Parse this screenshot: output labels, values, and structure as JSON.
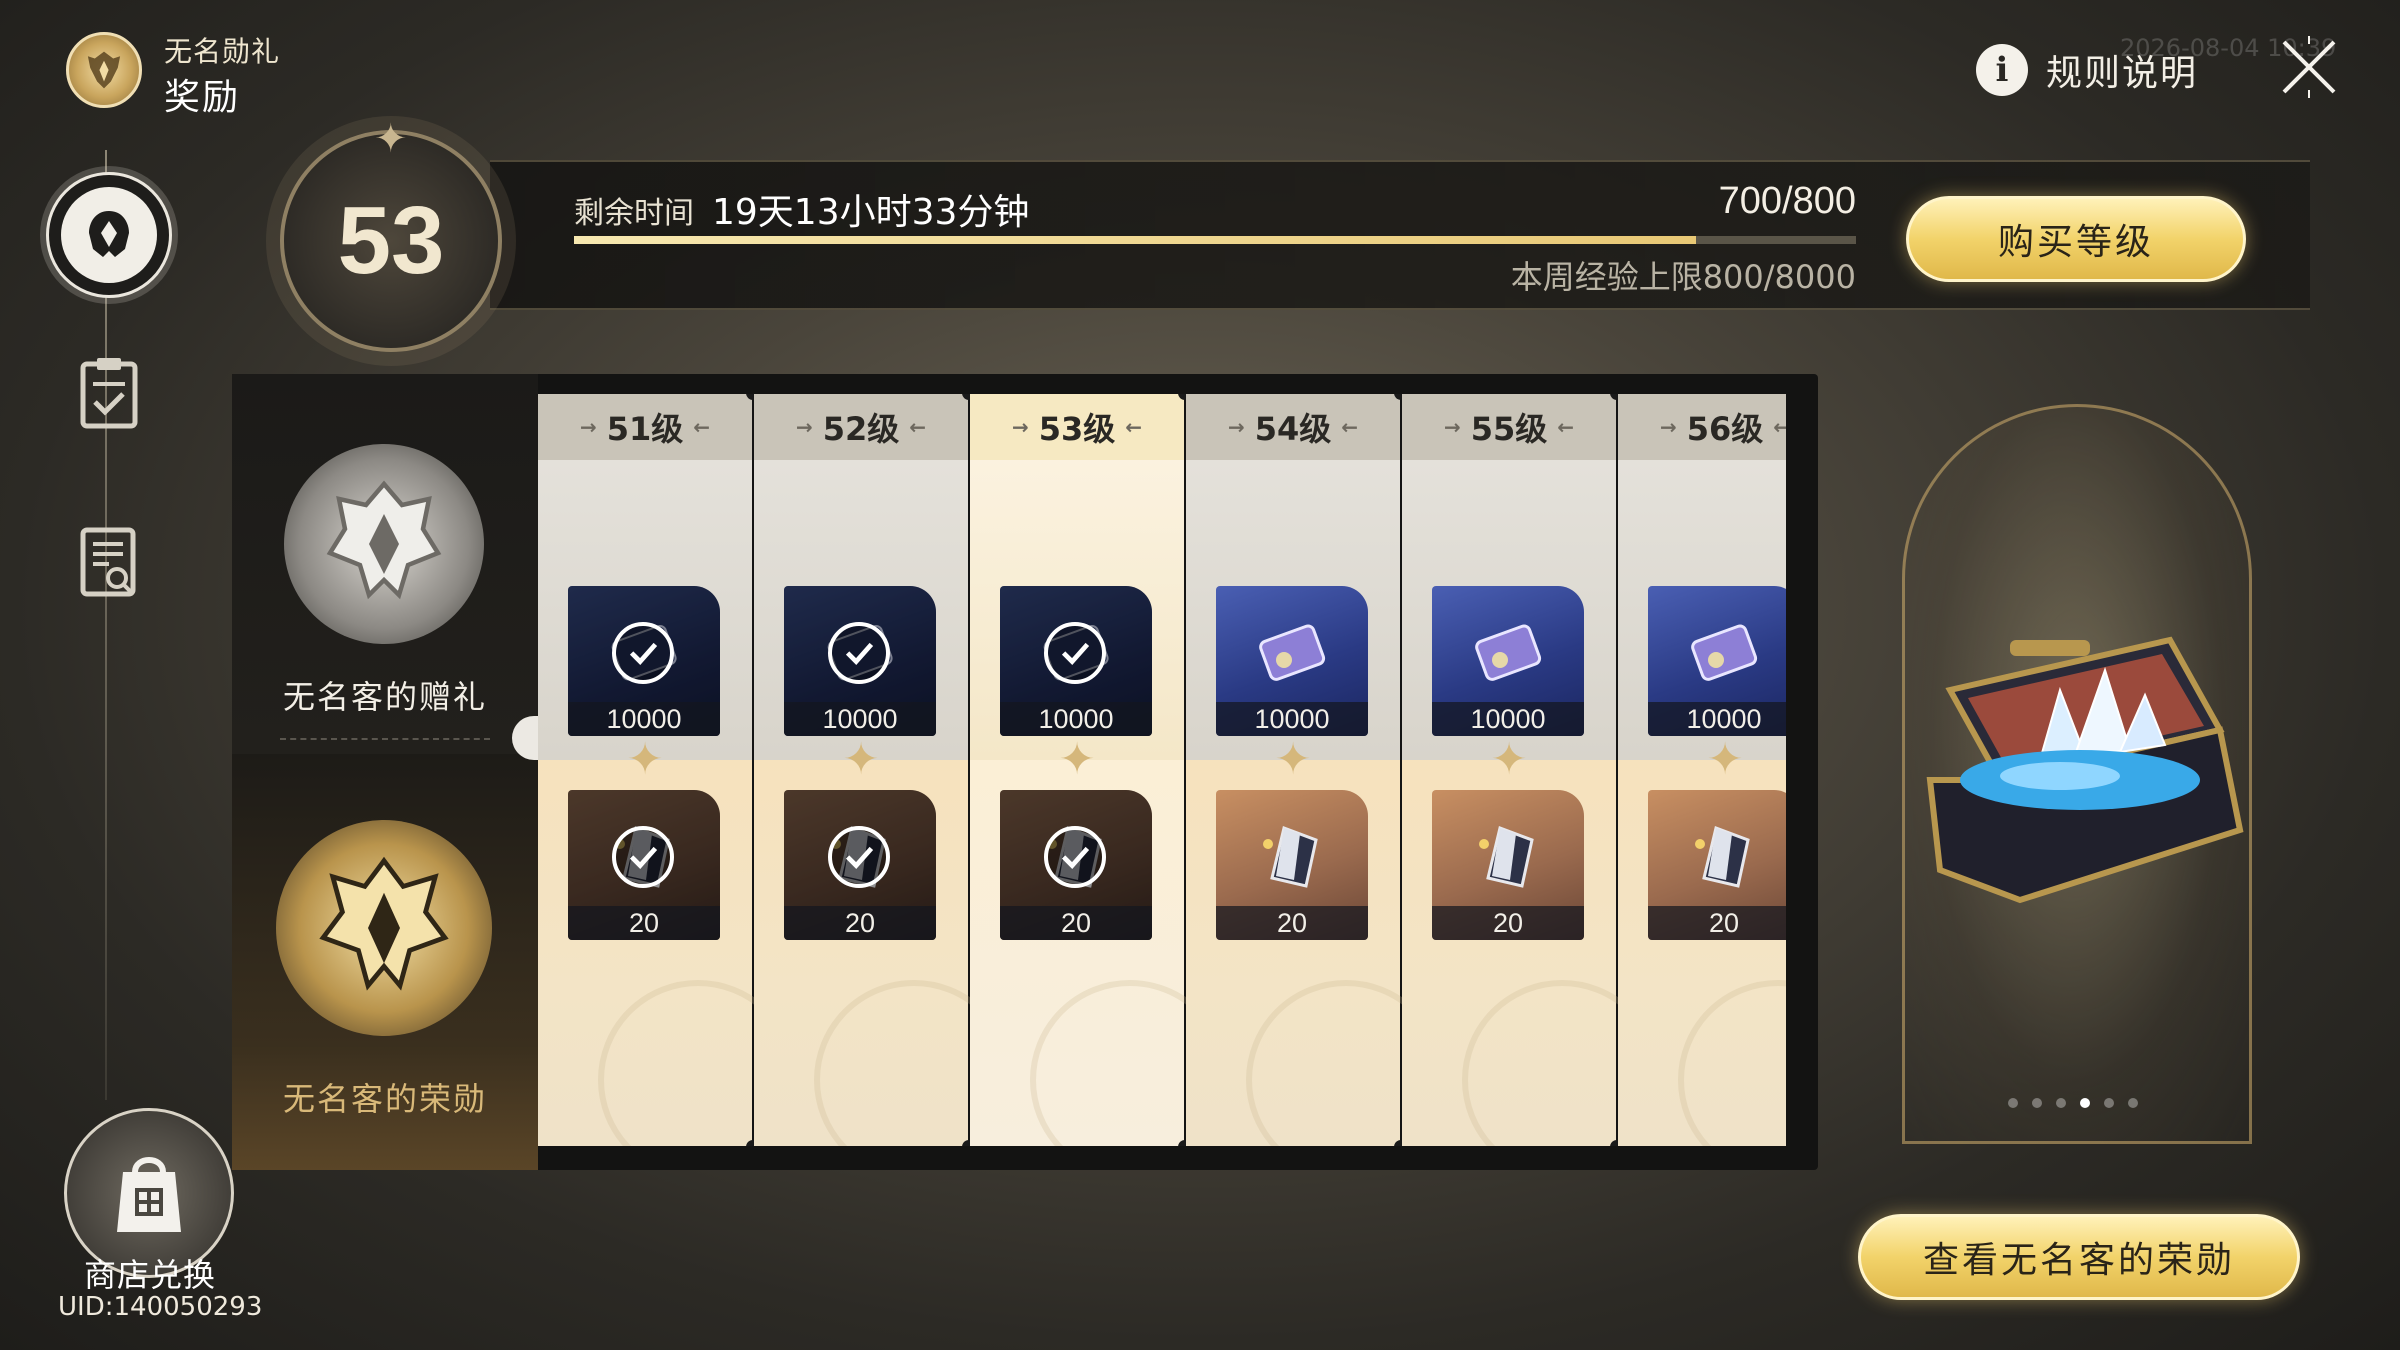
{
  "header": {
    "event_name": "无名勋礼",
    "page_title": "奖励",
    "rules_label": "规则说明",
    "watermark": "2026-08-04 10:39"
  },
  "level": {
    "current": "53",
    "time_label": "剩余时间",
    "time_value": "19天13小时33分钟",
    "exp_value": "700/800",
    "exp_fraction": 0.875,
    "weekly_cap": "本周经验上限800/8000"
  },
  "buttons": {
    "buy_level": "购买等级",
    "view_honor": "查看无名客的荣勋"
  },
  "tracks": {
    "free_name": "无名客的赠礼",
    "paid_name": "无名客的荣勋"
  },
  "columns": [
    {
      "level": "51级",
      "free_qty": "10000",
      "free_claimed": true,
      "paid_qty": "20",
      "paid_claimed": true,
      "current": false
    },
    {
      "level": "52级",
      "free_qty": "10000",
      "free_claimed": true,
      "paid_qty": "20",
      "paid_claimed": true,
      "current": false
    },
    {
      "level": "53级",
      "free_qty": "10000",
      "free_claimed": true,
      "paid_qty": "20",
      "paid_claimed": true,
      "current": true
    },
    {
      "level": "54级",
      "free_qty": "10000",
      "free_claimed": false,
      "paid_qty": "20",
      "paid_claimed": false,
      "current": false
    },
    {
      "level": "55级",
      "free_qty": "10000",
      "free_claimed": false,
      "paid_qty": "20",
      "paid_claimed": false,
      "current": false
    },
    {
      "level": "56级",
      "free_qty": "10000",
      "free_claimed": false,
      "paid_qty": "20",
      "paid_claimed": false,
      "current": false
    }
  ],
  "sidebar": {
    "shop_label": "商店兑换",
    "uid": "UID:140050293"
  },
  "preview": {
    "page_count": 6,
    "active_page": 3
  },
  "icons": {
    "logo": "emblem-icon",
    "info": "info-icon",
    "close": "close-icon",
    "nav_rewards": "helmet-icon",
    "nav_missions": "clipboard-icon",
    "nav_records": "document-search-icon",
    "shop": "shopping-bag-icon"
  },
  "colors": {
    "accent_gold": "#f2d36a",
    "current_column": "#f6e9c2"
  }
}
